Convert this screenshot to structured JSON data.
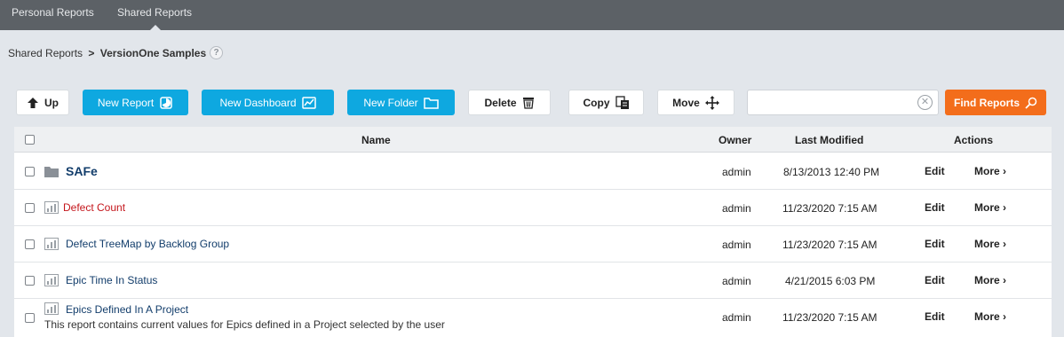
{
  "top_tabs": [
    {
      "label": "Personal Reports"
    },
    {
      "label": "Shared Reports"
    }
  ],
  "breadcrumb": {
    "parent": "Shared Reports",
    "separator": ">",
    "current": "VersionOne Samples",
    "help": "?"
  },
  "toolbar": {
    "up": "Up",
    "new_report": "New Report",
    "new_dashboard": "New Dashboard",
    "new_folder": "New Folder",
    "delete": "Delete",
    "copy": "Copy",
    "move": "Move",
    "search_value": "",
    "find_reports": "Find Reports"
  },
  "table": {
    "headers": {
      "name": "Name",
      "owner": "Owner",
      "last_modified": "Last Modified",
      "actions": "Actions"
    },
    "rows": [
      {
        "type": "folder",
        "name": "SAFe",
        "description": "",
        "owner": "admin",
        "modified": "8/13/2013 12:40 PM",
        "edit": "Edit",
        "more": "More"
      },
      {
        "type": "report",
        "name": "Defect Count",
        "description": "",
        "owner": "admin",
        "modified": "11/23/2020 7:15 AM",
        "edit": "Edit",
        "more": "More"
      },
      {
        "type": "report",
        "name": "Defect TreeMap by Backlog Group",
        "description": "",
        "owner": "admin",
        "modified": "11/23/2020 7:15 AM",
        "edit": "Edit",
        "more": "More"
      },
      {
        "type": "report",
        "name": "Epic Time In Status",
        "description": "",
        "owner": "admin",
        "modified": "4/21/2015 6:03 PM",
        "edit": "Edit",
        "more": "More"
      },
      {
        "type": "report",
        "name": "Epics Defined In A Project",
        "description": "This report contains current values for Epics defined in a Project selected by the user",
        "owner": "admin",
        "modified": "11/23/2020 7:15 AM",
        "edit": "Edit",
        "more": "More"
      }
    ]
  },
  "colors": {
    "topbar": "#5c6166",
    "primary_blue": "#0ea8e0",
    "find_orange": "#f36d1b",
    "link_blue": "#123d6b",
    "link_red": "#c4161c"
  }
}
